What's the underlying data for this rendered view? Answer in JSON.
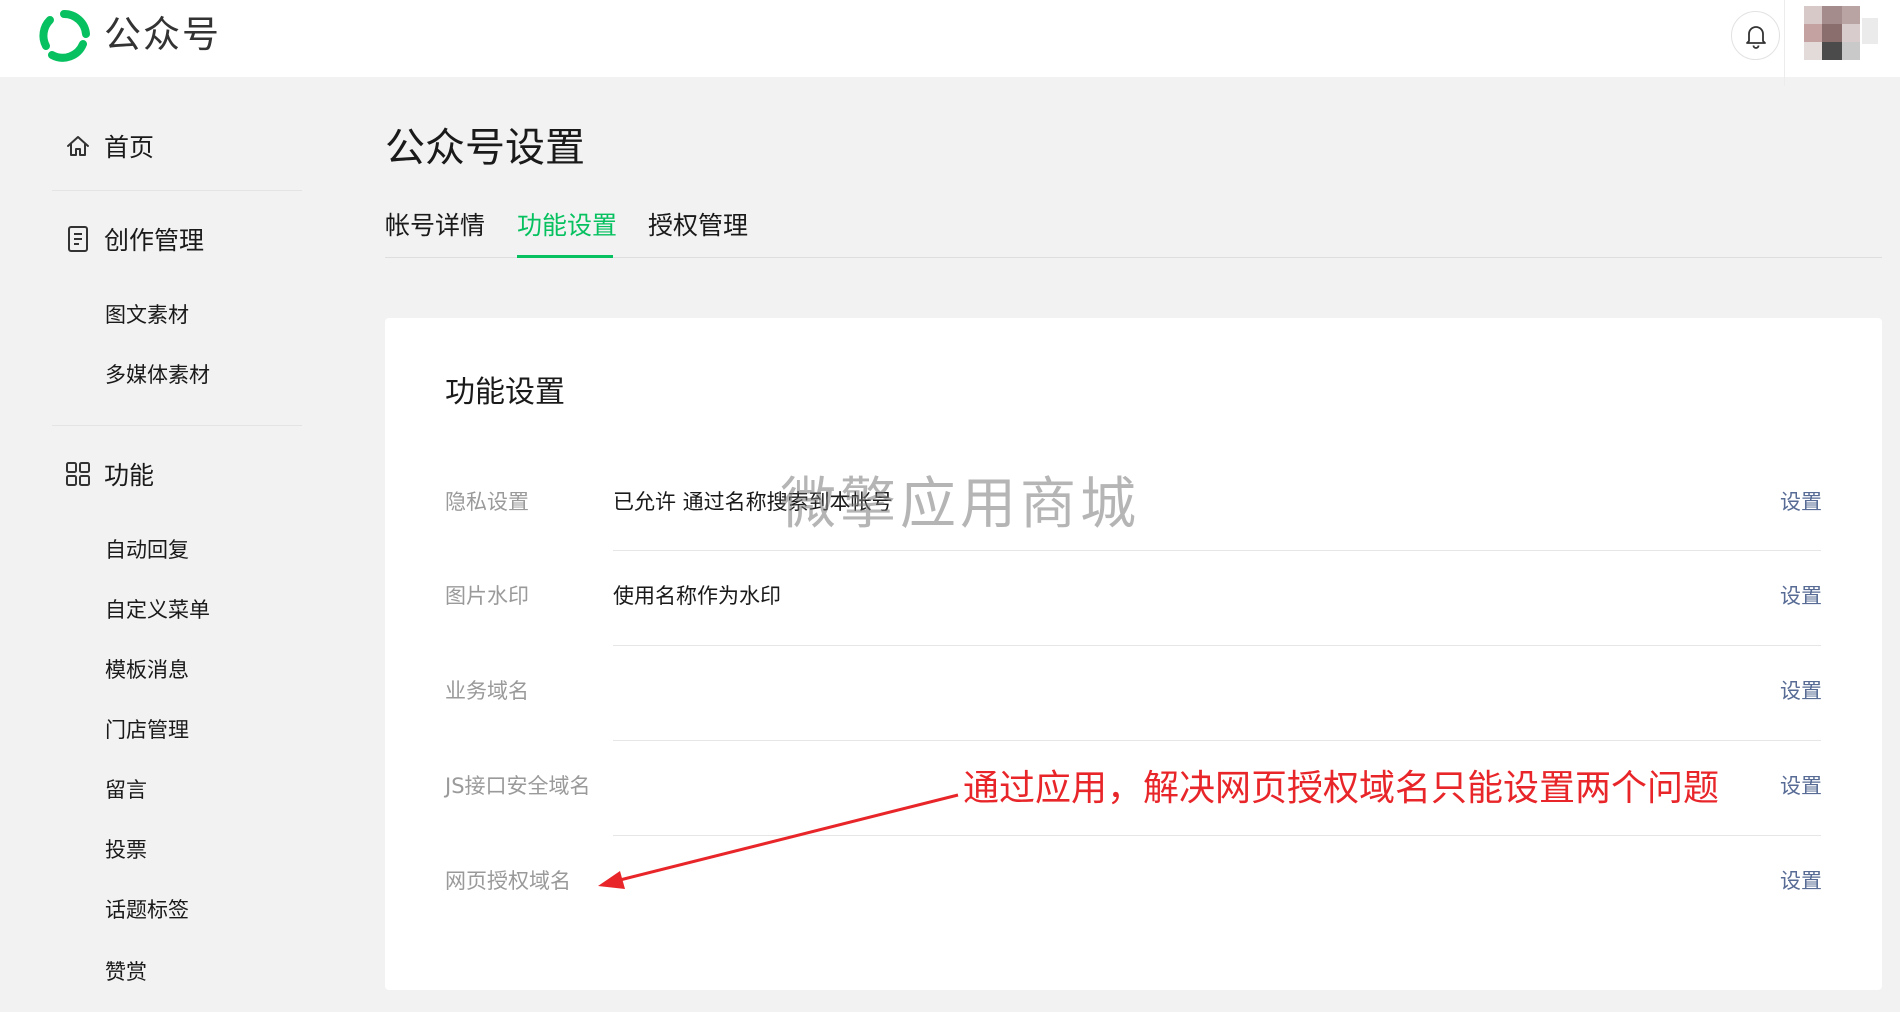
{
  "app": {
    "brand": "公众号",
    "logo_icon": "wechat-official-account-logo",
    "brand_color": "#07c160"
  },
  "topbar": {
    "notification_icon": "bell-icon"
  },
  "sidebar": {
    "home": {
      "label": "首页",
      "icon": "home-icon"
    },
    "content": {
      "label": "创作管理",
      "icon": "document-icon",
      "items": [
        "图文素材",
        "多媒体素材"
      ]
    },
    "features": {
      "label": "功能",
      "icon": "grid-icon",
      "items": [
        "自动回复",
        "自定义菜单",
        "模板消息",
        "门店管理",
        "留言",
        "投票",
        "话题标签",
        "赞赏"
      ]
    }
  },
  "main": {
    "title": "公众号设置",
    "tabs": [
      {
        "label": "帐号详情",
        "active": false
      },
      {
        "label": "功能设置",
        "active": true
      },
      {
        "label": "授权管理",
        "active": false
      }
    ],
    "card": {
      "title": "功能设置",
      "rows": [
        {
          "label": "隐私设置",
          "value": "已允许 通过名称搜索到本帐号",
          "action": "设置"
        },
        {
          "label": "图片水印",
          "value": "使用名称作为水印",
          "action": "设置"
        },
        {
          "label": "业务域名",
          "value": "",
          "action": "设置"
        },
        {
          "label": "JS接口安全域名",
          "value": "",
          "action": "设置"
        },
        {
          "label": "网页授权域名",
          "value": "",
          "action": "设置"
        }
      ]
    }
  },
  "overlay": {
    "watermark": "微擎应用商城",
    "annotation": "通过应用，解决网页授权域名只能设置两个问题",
    "annotation_color": "#e8262a",
    "action_color": "#576b95"
  }
}
